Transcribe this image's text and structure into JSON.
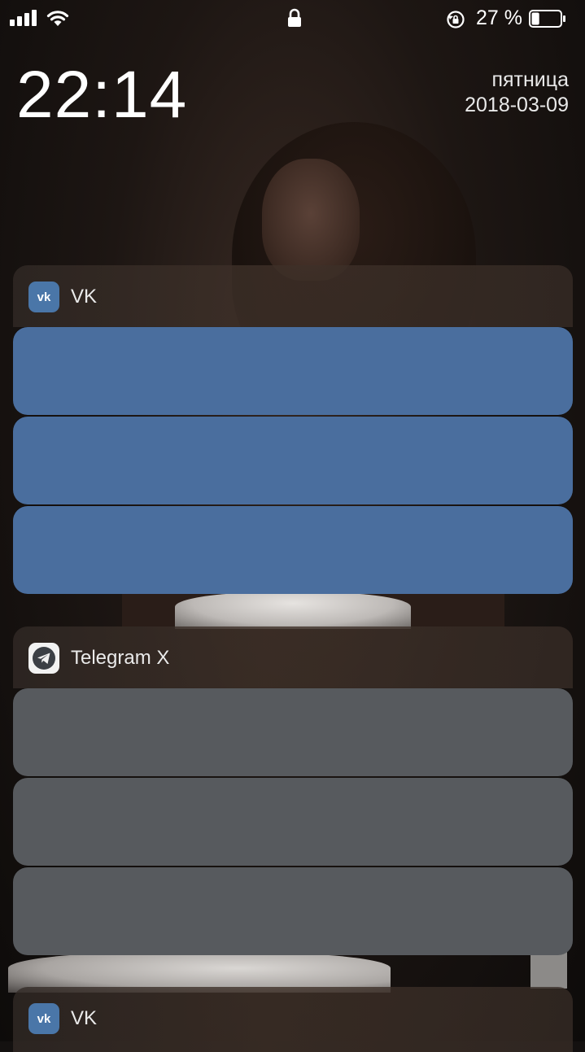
{
  "status_bar": {
    "battery_percent_text": "27 %",
    "battery_level": 0.27,
    "signal_bars": 4,
    "icons": [
      "cellular-signal-icon",
      "wifi-icon",
      "lock-icon",
      "rotation-lock-icon",
      "battery-icon"
    ]
  },
  "lockscreen": {
    "time": "22:14",
    "weekday": "пятница",
    "date": "2018-03-09"
  },
  "notification_groups": [
    {
      "app_name": "VK",
      "icon": "vk-icon",
      "accent": "#4a6e9e",
      "cards": 3
    },
    {
      "app_name": "Telegram X",
      "icon": "telegram-icon",
      "accent": "#575a5e",
      "cards": 3
    },
    {
      "app_name": "VK",
      "icon": "vk-icon",
      "accent": "#4a6e9e",
      "cards": 0
    }
  ]
}
